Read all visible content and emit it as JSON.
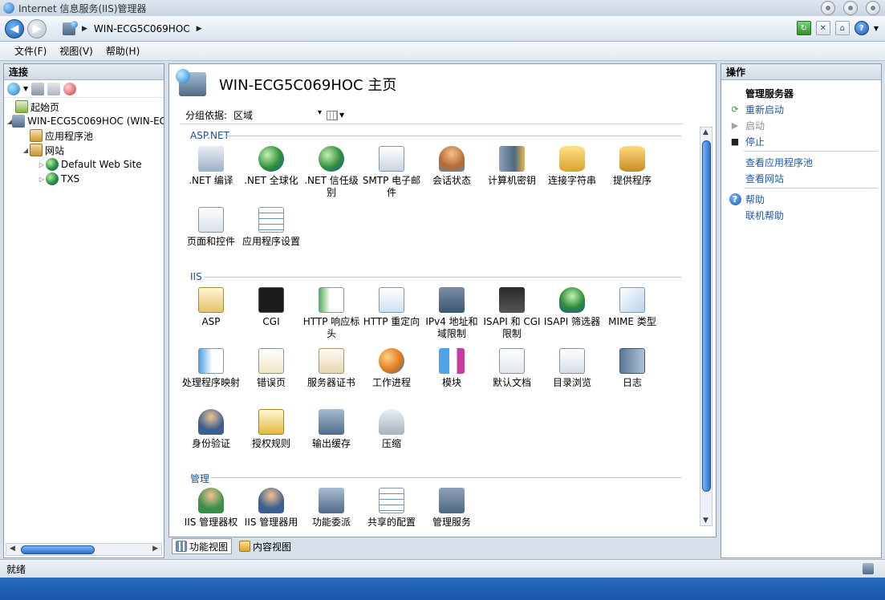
{
  "window": {
    "title": "Internet 信息服务(IIS)管理器"
  },
  "address": {
    "crumb": "WIN-ECG5C069HOC"
  },
  "menu": [
    "文件(F)",
    "视图(V)",
    "帮助(H)"
  ],
  "connections": {
    "title": "连接",
    "tree": [
      {
        "label": "起始页",
        "icon": "start-page-icon",
        "level": 0
      },
      {
        "label": "WIN-ECG5C069HOC (WIN-EC",
        "icon": "server-icon",
        "level": 0
      },
      {
        "label": "应用程序池",
        "icon": "app-pool-icon",
        "level": 1
      },
      {
        "label": "网站",
        "icon": "sites-icon",
        "level": 1
      },
      {
        "label": "Default Web Site",
        "icon": "globe-icon",
        "level": 2
      },
      {
        "label": "TXS",
        "icon": "globe-icon",
        "level": 2
      }
    ]
  },
  "home": {
    "title": "WIN-ECG5C069HOC 主页",
    "group_label": "分组依据:",
    "group_value": "区域"
  },
  "sections": {
    "aspnet": {
      "title": "ASP.NET",
      "items": [
        ".NET 编译",
        ".NET 全球化",
        ".NET 信任级别",
        "SMTP 电子邮件",
        "会话状态",
        "计算机密钥",
        "连接字符串",
        "提供程序",
        "页面和控件",
        "应用程序设置"
      ]
    },
    "iis": {
      "title": "IIS",
      "items": [
        "ASP",
        "CGI",
        "HTTP 响应标头",
        "HTTP 重定向",
        "IPv4 地址和域限制",
        "ISAPI 和 CGI 限制",
        "ISAPI 筛选器",
        "MIME 类型",
        "处理程序映射",
        "错误页",
        "服务器证书",
        "工作进程",
        "模块",
        "默认文档",
        "目录浏览",
        "日志",
        "身份验证",
        "授权规则",
        "输出缓存",
        "压缩"
      ]
    },
    "manage": {
      "title": "管理",
      "items": [
        "IIS 管理器权",
        "IIS 管理器用",
        "功能委派",
        "共享的配置",
        "管理服务"
      ]
    }
  },
  "view_tabs": {
    "features": "功能视图",
    "content": "内容视图"
  },
  "actions": {
    "title": "操作",
    "manage_server": "管理服务器",
    "restart": "重新启动",
    "start": "启动",
    "stop": "停止",
    "view_pools": "查看应用程序池",
    "view_sites": "查看网站",
    "help": "帮助",
    "online_help": "联机帮助"
  },
  "status": {
    "text": "就绪"
  },
  "colors": {
    "link": "#1f5aa6",
    "section": "#1e4f8f",
    "accent": "#2c6fd0"
  }
}
